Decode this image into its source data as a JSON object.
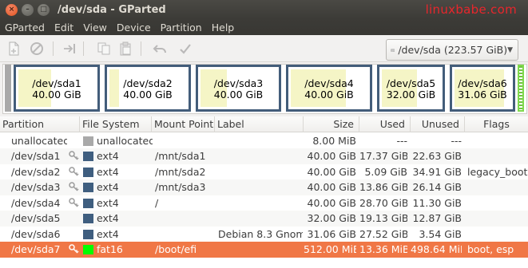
{
  "window": {
    "title": "/dev/sda - GParted",
    "watermark": "linuxbabe.com"
  },
  "menubar": {
    "items": [
      "GParted",
      "Edit",
      "View",
      "Device",
      "Partition",
      "Help"
    ]
  },
  "toolbar": {
    "icons": [
      "new-icon",
      "delete-icon",
      "resize-move-icon",
      "copy-icon",
      "paste-icon",
      "undo-icon",
      "apply-icon"
    ],
    "device": "/dev/sda   (223.57 GiB)"
  },
  "partition_map": [
    {
      "name": "/dev/sda1",
      "size": "40.00 GiB",
      "used_fraction": 0.43
    },
    {
      "name": "/dev/sda2",
      "size": "40.00 GiB",
      "used_fraction": 0.13
    },
    {
      "name": "/dev/sda3",
      "size": "40.00 GiB",
      "used_fraction": 0.35
    },
    {
      "name": "/dev/sda4",
      "size": "40.00 GiB",
      "used_fraction": 0.72
    },
    {
      "name": "/dev/sda5",
      "size": "32.00 GiB",
      "used_fraction": 0.6
    },
    {
      "name": "/dev/sda6",
      "size": "31.06 GiB",
      "used_fraction": 0.89
    }
  ],
  "table": {
    "headers": [
      "Partition",
      "File System",
      "Mount Point",
      "Label",
      "Size",
      "Used",
      "Unused",
      "Flags"
    ],
    "rows": [
      {
        "partition": "unallocated",
        "fs": "unallocated",
        "fs_color": "#a9a9a9",
        "mount": "",
        "label": "",
        "size": "8.00 MiB",
        "used": "---",
        "unused": "---",
        "flags": "",
        "key": false
      },
      {
        "partition": "/dev/sda1",
        "fs": "ext4",
        "fs_color": "#3f5e7f",
        "mount": "/mnt/sda1",
        "label": "",
        "size": "40.00 GiB",
        "used": "17.37 GiB",
        "unused": "22.63 GiB",
        "flags": "",
        "key": true
      },
      {
        "partition": "/dev/sda2",
        "fs": "ext4",
        "fs_color": "#3f5e7f",
        "mount": "/mnt/sda2",
        "label": "",
        "size": "40.00 GiB",
        "used": "5.09 GiB",
        "unused": "34.91 GiB",
        "flags": "legacy_boot",
        "key": true
      },
      {
        "partition": "/dev/sda3",
        "fs": "ext4",
        "fs_color": "#3f5e7f",
        "mount": "/mnt/sda3",
        "label": "",
        "size": "40.00 GiB",
        "used": "13.86 GiB",
        "unused": "26.14 GiB",
        "flags": "",
        "key": true
      },
      {
        "partition": "/dev/sda4",
        "fs": "ext4",
        "fs_color": "#3f5e7f",
        "mount": "/",
        "label": "",
        "size": "40.00 GiB",
        "used": "28.70 GiB",
        "unused": "11.30 GiB",
        "flags": "",
        "key": true
      },
      {
        "partition": "/dev/sda5",
        "fs": "ext4",
        "fs_color": "#3f5e7f",
        "mount": "",
        "label": "",
        "size": "32.00 GiB",
        "used": "19.13 GiB",
        "unused": "12.87 GiB",
        "flags": "",
        "key": false
      },
      {
        "partition": "/dev/sda6",
        "fs": "ext4",
        "fs_color": "#3f5e7f",
        "mount": "",
        "label": "Debian 8.3 Gnome",
        "size": "31.06 GiB",
        "used": "27.52 GiB",
        "unused": "3.54 GiB",
        "flags": "",
        "key": false
      },
      {
        "partition": "/dev/sda7",
        "fs": "fat16",
        "fs_color": "#00ff00",
        "mount": "/boot/efi",
        "label": "",
        "size": "512.00 MiB",
        "used": "13.36 MiB",
        "unused": "498.64 MiB",
        "flags": "boot, esp",
        "key": true,
        "selected": true
      }
    ]
  },
  "colors": {
    "accent_selected": "#f07746",
    "partition_border": "#435d7a",
    "used_fill": "#f5f5c6"
  }
}
